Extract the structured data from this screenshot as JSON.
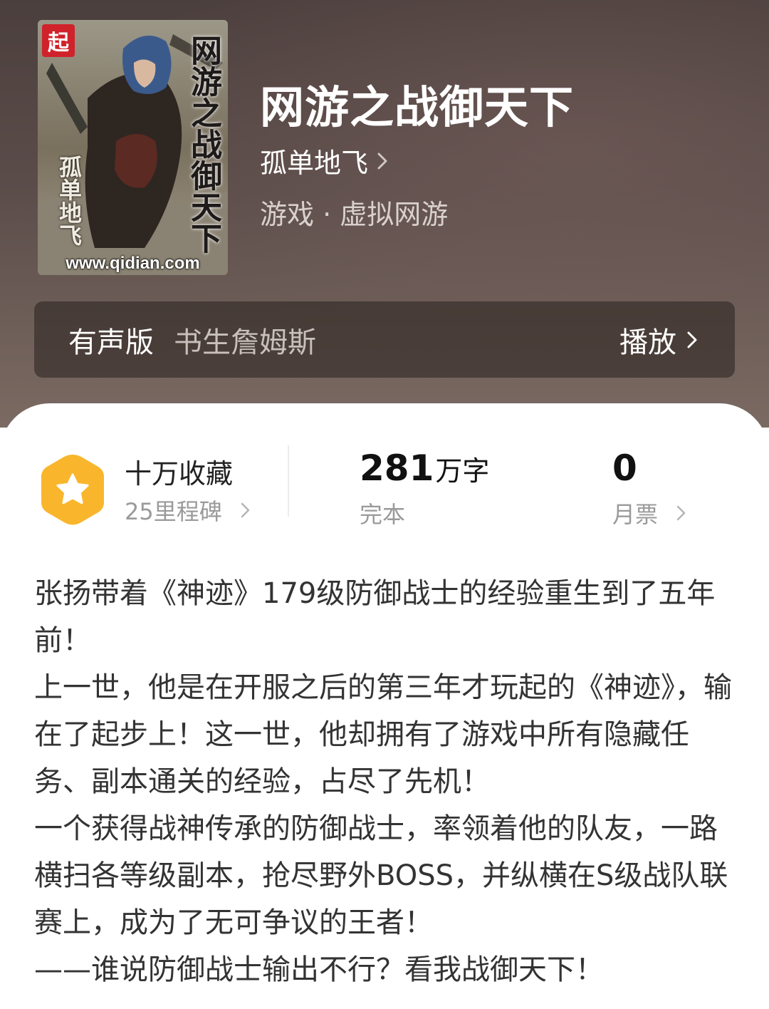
{
  "book": {
    "cover": {
      "logo_glyph": "起",
      "title_text": "网游之战御天下",
      "author_text": "孤单地飞",
      "url_text": "www.qidian.com"
    },
    "title": "网游之战御天下",
    "author": "孤单地飞",
    "genre": "游戏 · 虚拟网游"
  },
  "audio": {
    "label": "有声版",
    "narrator": "书生詹姆斯",
    "play_label": "播放"
  },
  "stats": {
    "collection_title": "十万收藏",
    "collection_sub": "25里程碑",
    "word_count": "281",
    "word_unit": "万字",
    "status": "完本",
    "monthly_votes": "0",
    "monthly_label": "月票"
  },
  "synopsis": [
    "张扬带着《神迹》179级防御战士的经验重生到了五年前！",
    "上一世，他是在开服之后的第三年才玩起的《神迹》，输在了起步上！这一世，他却拥有了游戏中所有隐藏任务、副本通关的经验，占尽了先机！",
    "一个获得战神传承的防御战士，率领着他的队友，一路横扫各等级副本，抢尽野外BOSS，并纵横在S级战队联赛上，成为了无可争议的王者！",
    "——谁说防御战士输出不行？看我战御天下！"
  ],
  "colors": {
    "header_bg": "#54463f",
    "badge_orange": "#f9b62d",
    "text_dark": "#333333",
    "text_muted": "#9a9a9a"
  },
  "icons": [
    "chevron-right-icon",
    "star-badge-icon",
    "qidian-logo-icon"
  ]
}
